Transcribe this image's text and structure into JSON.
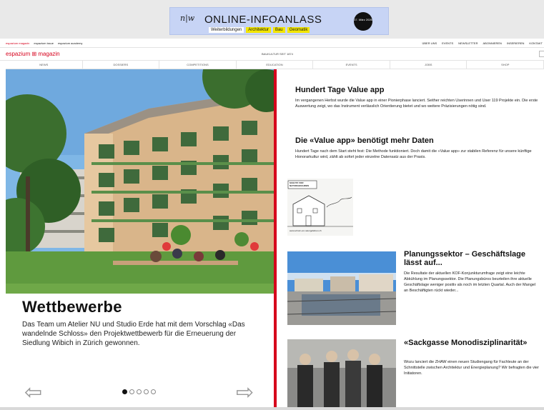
{
  "banner": {
    "logo": "n|w",
    "title": "ONLINE-INFOANLASS",
    "tags": [
      "Weiterbildungen",
      "Architektur",
      "Bau",
      "Geomatik"
    ],
    "badge": "17. März 2026"
  },
  "topnav": {
    "left": [
      "espazium magazin",
      "espazium issue",
      "espazium academy"
    ],
    "right": [
      "ÜBER UNS",
      "EVENTS",
      "NEWSLETTER",
      "ABONNIEREN",
      "INSERIEREN",
      "KONTAKT"
    ]
  },
  "brand": {
    "logo": "espazium ⊞ magazin",
    "tagline": "BAUKULTUR SEIT 1874"
  },
  "mainnav": [
    "NEWS",
    "DOSSIERS",
    "COMPETITIONS",
    "EDUCATION",
    "EVENTS",
    "JOBS",
    "SHOP"
  ],
  "hero": {
    "title": "Wettbewerbe",
    "text": "Das Team um Atelier NU und Studio Erde hat mit dem Vorschlag «Das wandelnde Schloss» den Projektwettbewerb für die Erneuerung der Siedlung Wibich in Zürich gewonnen.",
    "prev_icon": "⇦",
    "next_icon": "⇨"
  },
  "articles": [
    {
      "title": "Hundert Tage Value app",
      "text": "Im vergangenen Herbst wurde die Value app in einer Pionierphase lanciert. Seither reichten Userinnen und User 119 Projekte ein. Die erste Auswertung zeigt, wo das Instrument verlässlich Orientierung bietet und wo weitere Präzisierungen nötig sind."
    },
    {
      "title": "Die «Value app» benötigt mehr Daten",
      "text": "Hundert Tage nach dem Start steht fest: Die Methode funktioniert. Doch damit die «Value app» zur stabilen Referenz für unsere künftige Honorarkultur wird, zählt ab sofort jeder einzelne Datensatz aus der Praxis.",
      "ad_label": "SCHUTZ VOR NATURGEFAHREN",
      "ad_url": "www.schutz-vor-naturgefahren.ch"
    },
    {
      "title": "Planungssektor – Geschäftslage lässt auf...",
      "text": "Die Resultate der aktuellen KOF-Konjunkturumfrage zeigt eine leichte Abkühlung im Planungssektor. Die Planungsbüros beurteilen ihre aktuelle Geschäftslage weniger positiv als noch im letzten Quartal. Auch der Mangel an Beschäftigten rückt wieder..."
    },
    {
      "title": "«Sackgasse Monodisziplinarität»",
      "text": "Wozu lanciert die ZHAW einen neuen Studiengang für Fachleute an der Schnittstelle zwischen Architektur und Energieplanung? Wir befragten die vier Initiatoren."
    }
  ],
  "colors": {
    "accent": "#d6001c",
    "banner_bg": "#c7d4f5",
    "highlight": "#f3e600"
  }
}
